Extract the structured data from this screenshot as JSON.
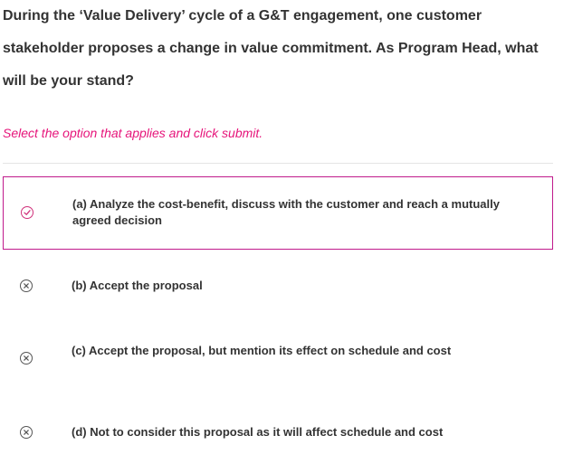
{
  "question": {
    "text": "During the ‘Value Delivery’ cycle of a G&T engagement, one customer stakeholder proposes a change in value commitment. As Program Head, what will be your stand?"
  },
  "instruction": "Select the option that applies and click submit.",
  "colors": {
    "accent_pink": "#e6147a",
    "selected_border": "#c01a8c",
    "text": "#333333"
  },
  "options": [
    {
      "label": "(a) Analyze the cost-benefit, discuss with the customer and reach a mutually agreed decision",
      "icon": "check-circle-icon",
      "selected": true
    },
    {
      "label": "(b) Accept the proposal",
      "icon": "x-circle-icon",
      "selected": false
    },
    {
      "label": "(c) Accept the proposal, but mention its effect on schedule and cost",
      "icon": "x-circle-icon",
      "selected": false
    },
    {
      "label": "(d) Not to consider this proposal as it will affect schedule and cost",
      "icon": "x-circle-icon",
      "selected": false
    }
  ]
}
